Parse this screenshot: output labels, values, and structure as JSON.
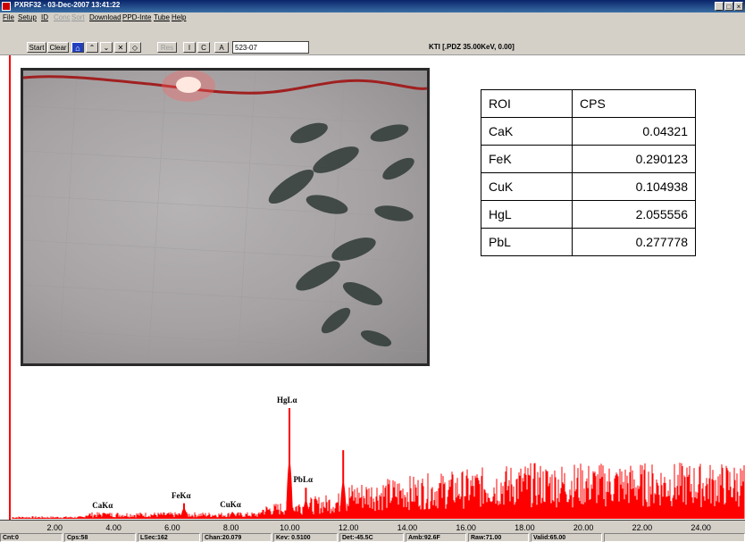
{
  "window": {
    "title": "PXRF32 - 03-Dec-2007 13:41:22",
    "controls": [
      "_",
      "□",
      "×"
    ]
  },
  "menu": [
    "File",
    "Setup",
    "ID",
    "Conc",
    "Sort",
    "Download",
    "PPD-Inte",
    "Tube",
    "Help"
  ],
  "menu_disabled": [
    "Conc",
    "Sort"
  ],
  "toolbar": {
    "start_label": "Start",
    "clear_label": "Clear",
    "nav_icons": [
      "home-icon",
      "arrow-up-icon",
      "arrow-down-icon",
      "x-box-icon",
      "diamond-icon"
    ],
    "res_label": "Res",
    "i_label": "I",
    "c_label": "C",
    "a_label": "A",
    "sample_value": "523-07",
    "kti_info": "KTI [.PDZ 35.00KeV, 0.00]"
  },
  "roi_table": {
    "headers": [
      "ROI",
      "CPS"
    ],
    "rows": [
      [
        "CaK",
        "0.04321"
      ],
      [
        "FeK",
        "0.290123"
      ],
      [
        "CuK",
        "0.104938"
      ],
      [
        "HgL",
        "2.055556"
      ],
      [
        "PbL",
        "0.277778"
      ]
    ]
  },
  "chart_data": {
    "type": "bar",
    "xlim": [
      0.5,
      25.5
    ],
    "x_ticks": [
      "2.00",
      "4.00",
      "6.00",
      "8.00",
      "10.00",
      "12.00",
      "14.00",
      "16.00",
      "18.00",
      "20.00",
      "22.00",
      "24.00"
    ],
    "series_color": "#ff0000",
    "peaks": [
      {
        "label": "CaKα",
        "kev": 3.7,
        "height": 0.05
      },
      {
        "label": "FeKα",
        "kev": 6.4,
        "height": 0.14
      },
      {
        "label": "CuKα",
        "kev": 8.05,
        "height": 0.06
      },
      {
        "label": "HgLα",
        "kev": 9.99,
        "height": 1.0
      },
      {
        "label": "PbLα",
        "kev": 10.55,
        "height": 0.28
      }
    ],
    "background_peaks": [
      {
        "kev": 11.82,
        "height": 0.62
      },
      {
        "kev": 13.6,
        "height": 0.2
      }
    ]
  },
  "status": [
    "Cnt:0",
    "Cps:58",
    "LSec:162",
    "Chan:20.079",
    "Kev: 0.5100",
    "Det:-45.5C",
    "Amb:92.6F",
    "Raw:71.00",
    "Valid:65.00"
  ]
}
